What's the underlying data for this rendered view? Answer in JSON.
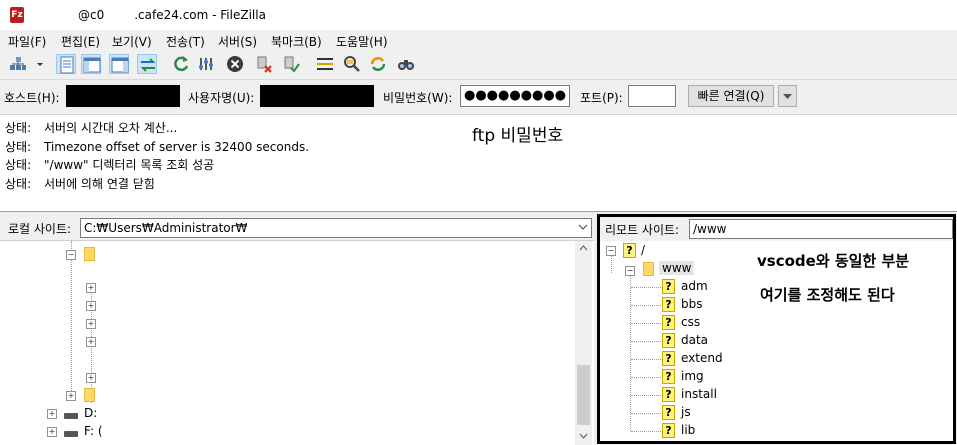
{
  "window": {
    "title_prefix": "@c0",
    "title_suffix": ".cafe24.com - FileZilla"
  },
  "menu": [
    "파일(F)",
    "편집(E)",
    "보기(V)",
    "전송(T)",
    "서버(S)",
    "북마크(B)",
    "도움말(H)"
  ],
  "toolbar": {
    "icons": [
      "site-manager-icon",
      "dropdown-arrow-icon",
      "message-log-icon",
      "local-tree-icon",
      "remote-tree-icon",
      "transfer-queue-icon",
      "refresh-icon",
      "process-queue-icon",
      "cancel-icon",
      "disconnect-icon",
      "reconnect-icon",
      "filter-icon",
      "toggle-compare-icon",
      "sync-browse-icon",
      "search-icon"
    ]
  },
  "quickconnect": {
    "host_label": "호스트(H):",
    "user_label": "사용자명(U):",
    "pass_label": "비밀번호(W):",
    "pass_value": "●●●●●●●●●",
    "port_label": "포트(P):",
    "port_value": "",
    "connect_label": "빠른 연결(Q)"
  },
  "log": {
    "rows": [
      {
        "key": "상태:",
        "text": "서버의 시간대 오차 계산..."
      },
      {
        "key": "상태:",
        "text": "Timezone offset of server is 32400 seconds."
      },
      {
        "key": "상태:",
        "text": "\"/www\" 디렉터리 목록 조회 성공"
      },
      {
        "key": "상태:",
        "text": "서버에 의해 연결 닫힘"
      }
    ],
    "annotation": "ftp 비밀번호"
  },
  "local": {
    "label": "로컬 사이트:",
    "path": "C:₩Users₩Administrator₩",
    "drives": [
      "D:",
      "F: ("
    ]
  },
  "remote": {
    "label": "리모트 사이트:",
    "path": "/www",
    "root": "/",
    "www": "www",
    "folders": [
      "adm",
      "bbs",
      "css",
      "data",
      "extend",
      "img",
      "install",
      "js",
      "lib"
    ],
    "annotation_line1": "vscode와 동일한 부분",
    "annotation_line2": "여기를 조정해도 된다"
  }
}
